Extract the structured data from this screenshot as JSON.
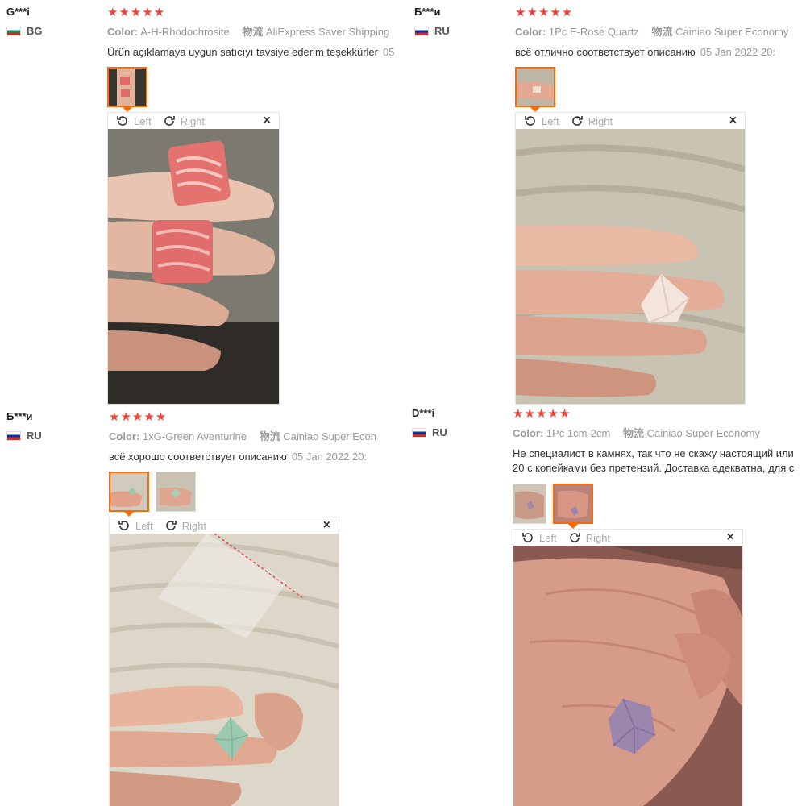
{
  "reviews": [
    {
      "user": "G***i",
      "country": "BG",
      "color_label": "Color:",
      "color_value": "A-H-Rhodochrosite",
      "logistics_label": "物流",
      "logistics_value": "AliExpress Saver Shipping",
      "text": "Ürün açıklamaya uygun satıcıyı tavsiye ederim teşekkürler",
      "date": "05"
    },
    {
      "user": "Б***и",
      "country": "RU",
      "color_label": "Color:",
      "color_value": "1Pc E-Rose Quartz",
      "logistics_label": "物流",
      "logistics_value": "Cainiao Super Economy",
      "text": "всё отлично соответствует описанию",
      "date": "05 Jan 2022 20:"
    },
    {
      "user": "Б***и",
      "country": "RU",
      "color_label": "Color:",
      "color_value": "1xG-Green Aventurine",
      "logistics_label": "物流",
      "logistics_value": "Cainiao Super Econ",
      "text": "всё хорошо соответствует описанию",
      "date": "05 Jan 2022 20:"
    },
    {
      "user": "D***i",
      "country": "RU",
      "color_label": "Color:",
      "color_value": "1Pc 1cm-2cm",
      "logistics_label": "物流",
      "logistics_value": "Cainiao Super Economy",
      "text": "Не специалист в камнях, так что не скажу настоящий или",
      "text2": "20 с копейками без претензий. Доставка адекватна, для с"
    }
  ],
  "viewer": {
    "left": "Left",
    "right": "Right",
    "close": "×"
  },
  "rating_stars": "★★★★★",
  "colors": {
    "star": "#f44336",
    "accent": "#ff6a00"
  }
}
